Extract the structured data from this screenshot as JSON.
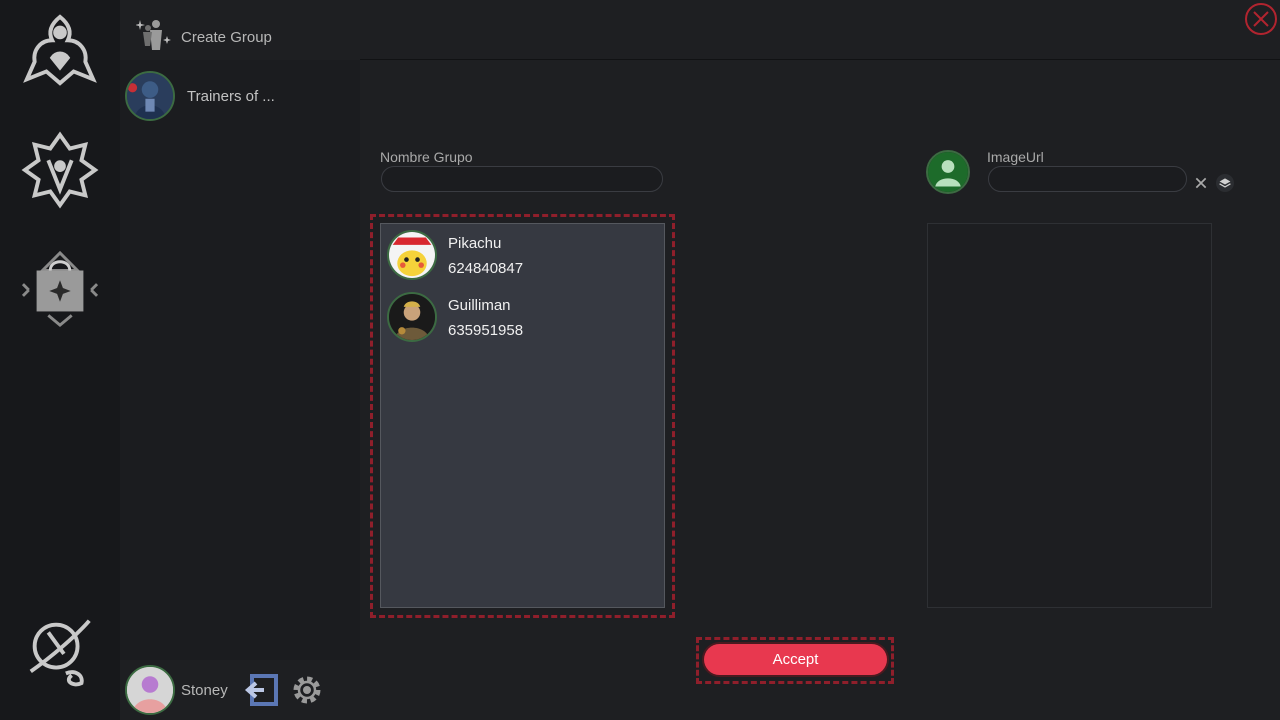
{
  "sidebar": {
    "create_group_label": "Create Group",
    "groups": [
      {
        "name": "Trainers of ..."
      }
    ],
    "user": {
      "name": "Stoney"
    }
  },
  "form": {
    "group_name_label": "Nombre Grupo",
    "group_name_value": "",
    "image_url_label": "ImageUrl",
    "image_url_value": ""
  },
  "members": [
    {
      "name": "Pikachu",
      "phone": "624840847"
    },
    {
      "name": "Guilliman",
      "phone": "635951958"
    }
  ],
  "actions": {
    "accept_label": "Accept"
  },
  "icons": {
    "rail": [
      "emblem-icon",
      "crest-icon",
      "shop-bag-icon",
      "planet-icon"
    ],
    "close": "close-circle-icon",
    "logout": "logout-icon",
    "settings": "gear-icon",
    "clear": "clear-x-icon",
    "layers": "layers-icon"
  },
  "colors": {
    "accent": "#e8384f",
    "highlight_border": "#8f1f2b",
    "avatar_ring": "#3c6b42"
  }
}
